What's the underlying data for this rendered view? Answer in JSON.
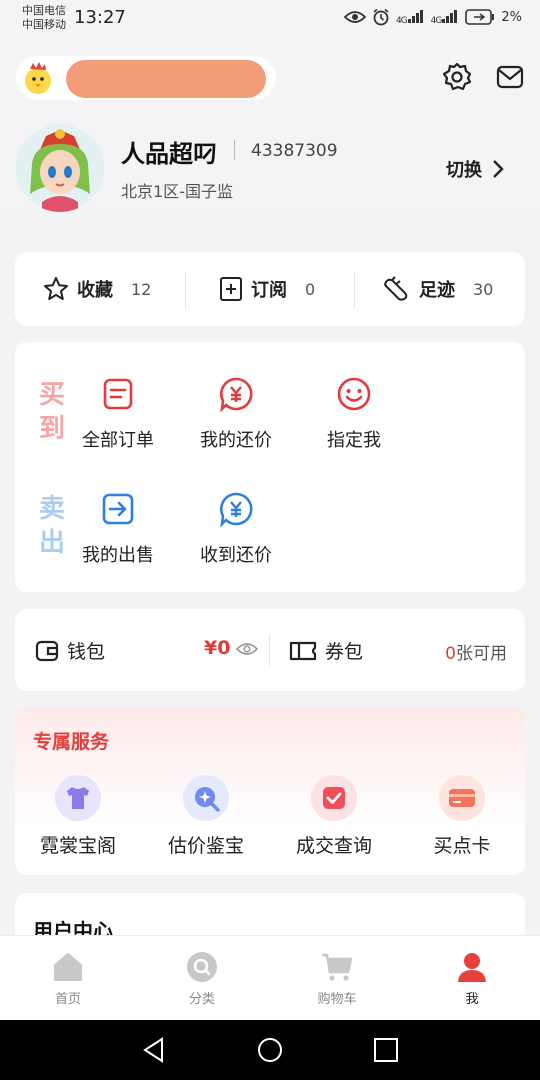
{
  "status_bar": {
    "carrier1": "中国电信",
    "carrier2": "中国移动",
    "time": "13:27",
    "signal1": "4G",
    "signal2": "4G",
    "battery": "2%"
  },
  "profile": {
    "nickname": "人品超叼",
    "user_id": "43387309",
    "server": "北京1区-国子监",
    "switch_label": "切换"
  },
  "stats": [
    {
      "label": "收藏",
      "count": "12",
      "icon": "star-icon"
    },
    {
      "label": "订阅",
      "count": "0",
      "icon": "subscribe-icon"
    },
    {
      "label": "足迹",
      "count": "30",
      "icon": "footprint-icon"
    }
  ],
  "orders": {
    "buy_label": "买到",
    "sell_label": "卖出",
    "buy_items": [
      {
        "label": "全部订单",
        "icon": "order-list-icon"
      },
      {
        "label": "我的还价",
        "icon": "yen-bubble-icon"
      },
      {
        "label": "指定我",
        "icon": "smile-icon"
      }
    ],
    "sell_items": [
      {
        "label": "我的出售",
        "icon": "sell-arrow-icon"
      },
      {
        "label": "收到还价",
        "icon": "yen-bubble-icon"
      }
    ]
  },
  "wallet": {
    "wallet_label": "钱包",
    "balance": "¥0",
    "coupon_label": "券包",
    "coupon_count": "0",
    "coupon_suffix": "张可用"
  },
  "services": {
    "title": "专属服务",
    "items": [
      {
        "label": "霓裳宝阁",
        "icon": "tshirt-icon",
        "color": "#8d7ae6"
      },
      {
        "label": "估价鉴宝",
        "icon": "appraise-icon",
        "color": "#6b8cf0"
      },
      {
        "label": "成交查询",
        "icon": "check-card-icon",
        "color": "#ef4f5a"
      },
      {
        "label": "买点卡",
        "icon": "card-icon",
        "color": "#f4745a"
      }
    ]
  },
  "user_center": {
    "title": "用户中心"
  },
  "tabs": [
    {
      "label": "首页",
      "icon": "home-icon"
    },
    {
      "label": "分类",
      "icon": "category-search-icon"
    },
    {
      "label": "购物车",
      "icon": "cart-icon"
    },
    {
      "label": "我",
      "icon": "user-icon"
    }
  ],
  "colors": {
    "accent": "#e33b3b",
    "buy": "#f3a0a0",
    "sell": "#a9cdf0",
    "blue": "#2f7fe0"
  }
}
